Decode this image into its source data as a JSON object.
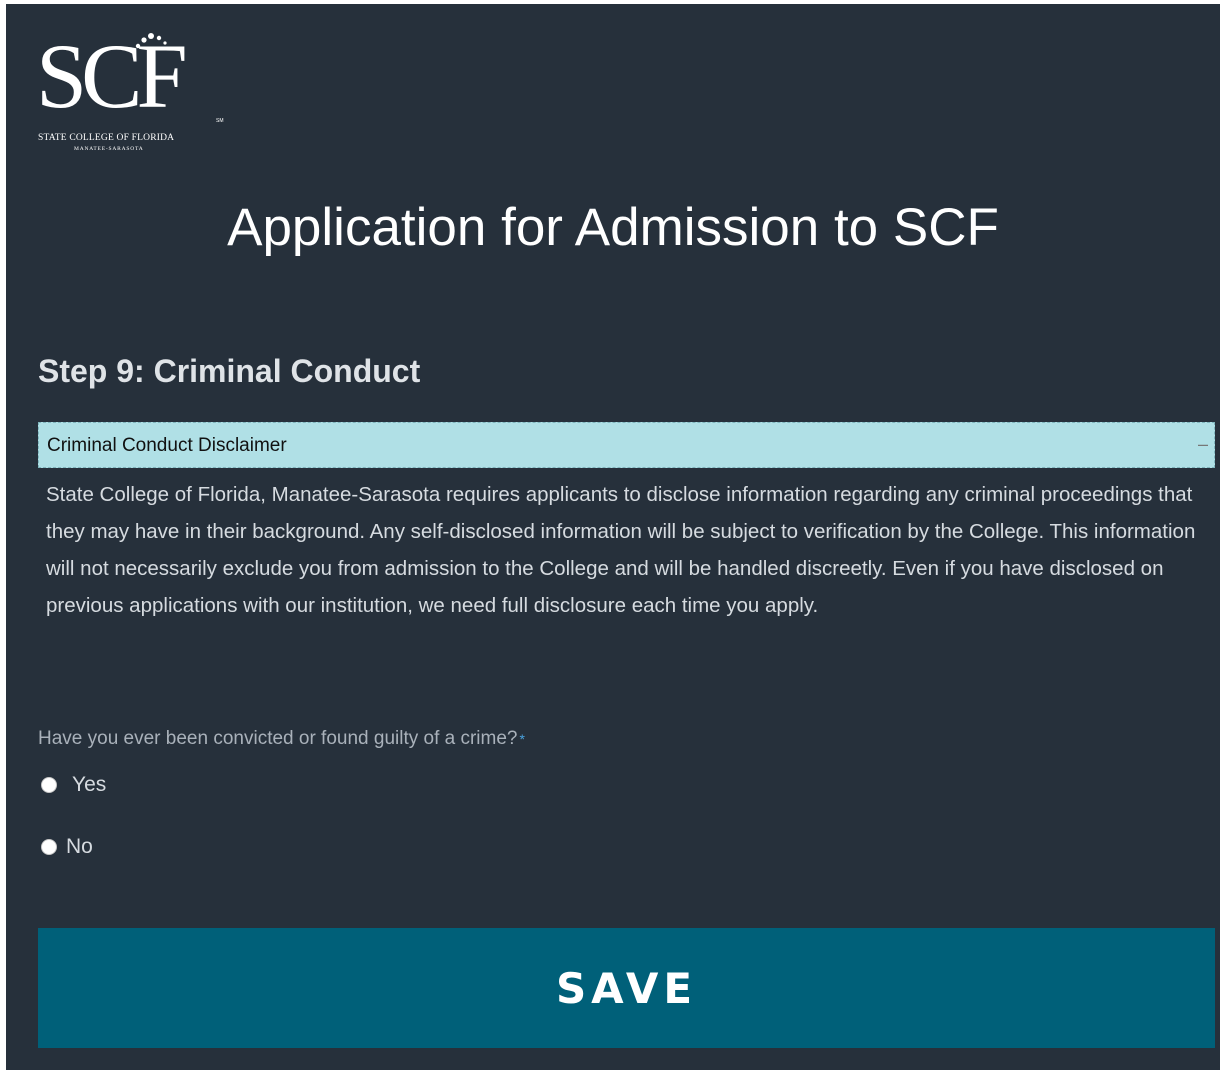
{
  "logo": {
    "letters": "SCF",
    "trademark": "SM",
    "line1": "STATE COLLEGE OF FLORIDA",
    "line2": "MANATEE-SARASOTA"
  },
  "page_title": "Application for Admission to SCF",
  "step_title": "Step 9: Criminal Conduct",
  "disclaimer": {
    "title": "Criminal Conduct Disclaimer",
    "toggle_icon": "collapse-icon",
    "toggle_symbol": "–",
    "body": "State College of Florida, Manatee-Sarasota requires applicants to disclose information regarding any criminal proceedings that they may have in their background. Any self-disclosed information will be subject to verification by the College. This information will not necessarily exclude you from admission to the College and will be handled discreetly. Even if you have disclosed on previous applications with our institution, we need full disclosure each time you apply."
  },
  "question": {
    "text": "Have you ever been convicted or found guilty of a crime?",
    "required_mark": "*",
    "options": [
      {
        "label": "Yes",
        "selected": false
      },
      {
        "label": "No",
        "selected": false
      }
    ]
  },
  "save_button": "SAVE",
  "colors": {
    "background": "#26303b",
    "panel_header": "#b0e0e6",
    "save_button": "#006079",
    "required": "#4aa3df"
  }
}
